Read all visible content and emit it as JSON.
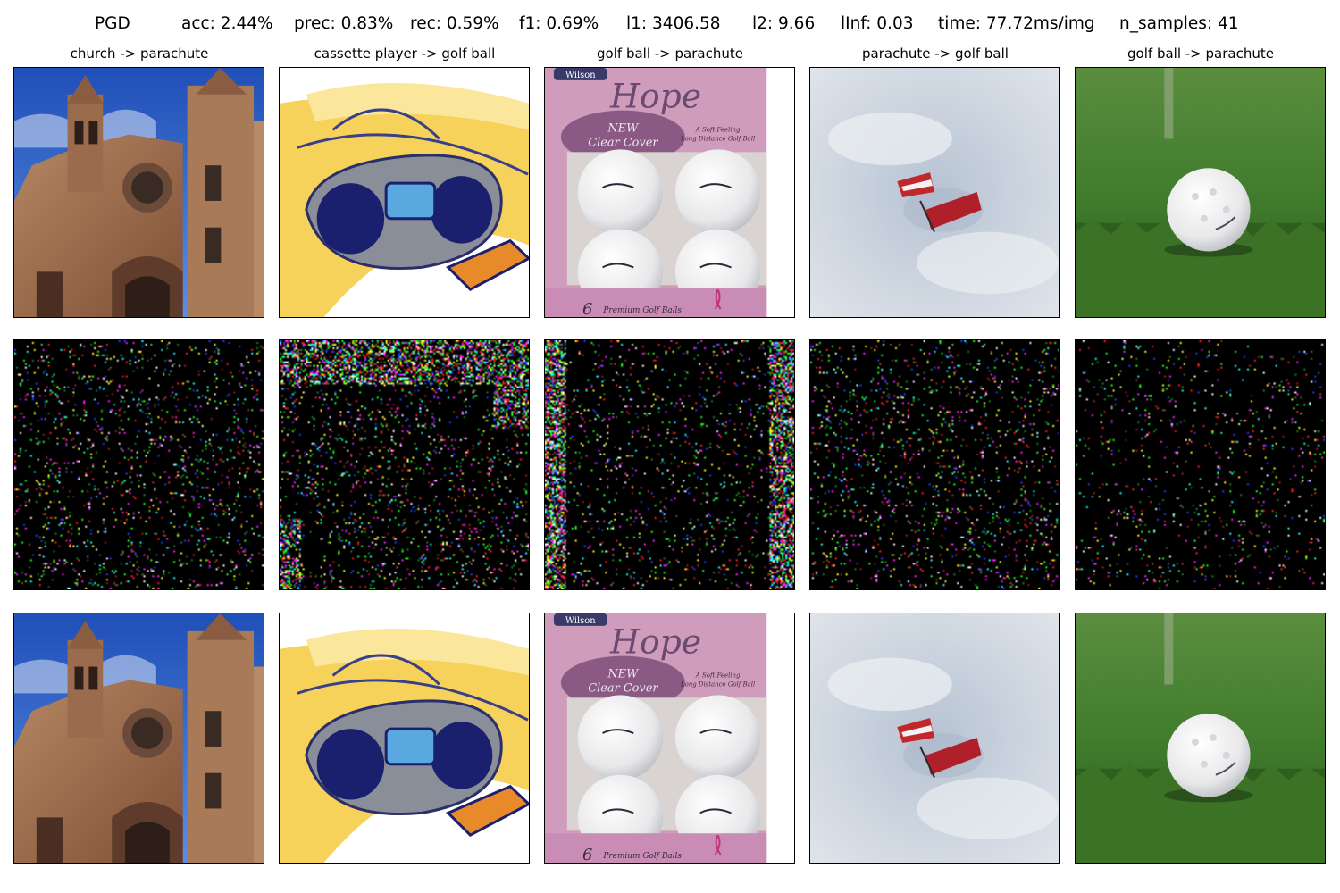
{
  "header": {
    "method": "PGD",
    "acc": "acc: 2.44%",
    "prec": "prec: 0.83%",
    "rec": "rec: 0.59%",
    "f1": "f1: 0.69%",
    "l1": "l1: 3406.58",
    "l2": "l2: 9.66",
    "linf": "lInf: 0.03",
    "time": "time: 77.72ms/img",
    "n_samples": "n_samples: 41"
  },
  "columns": [
    {
      "title": "church -> parachute",
      "image": "church-photo"
    },
    {
      "title": "cassette player -> golf ball",
      "image": "boombox-drawing"
    },
    {
      "title": "golf ball -> parachute",
      "image": "golf-ball-box-photo"
    },
    {
      "title": "parachute -> golf ball",
      "image": "parachute-sky-photo"
    },
    {
      "title": "golf ball -> parachute",
      "image": "golf-ball-grass-photo"
    }
  ],
  "rows": [
    "original-image",
    "perturbation",
    "adversarial-image"
  ],
  "box_text": {
    "brand": "Wilson",
    "script": "Hope",
    "new1": "NEW",
    "new2": "Clear Cover",
    "soft1": "A Soft Feeling",
    "soft2": "Long Distance Golf Ball",
    "count": "6",
    "premium": "Premium Golf Balls"
  },
  "colors": {
    "sky_blue": "#2a62c9",
    "brick": "#9a6a4a",
    "poster_yellow": "#f6d25a",
    "boombox_navy": "#1a1f6e",
    "box_pink": "#cf9cbc",
    "sky_grey": "#c9d3de",
    "grass_green": "#3f7a2c",
    "noise_bg": "#000000"
  }
}
